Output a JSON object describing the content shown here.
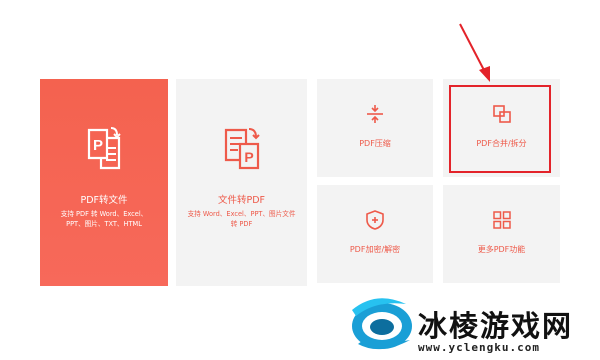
{
  "cards": {
    "pdf_to_file": {
      "title": "PDF转文件",
      "desc_line1": "支持 PDF 转 Word、Excel、",
      "desc_line2": "PPT、图片、TXT、HTML"
    },
    "file_to_pdf": {
      "title": "文件转PDF",
      "desc_line1": "支持 Word、Excel、PPT、图片文件",
      "desc_line2": "转 PDF"
    },
    "compress": {
      "label": "PDF压缩"
    },
    "merge_split": {
      "label": "PDF合并/拆分"
    },
    "encrypt": {
      "label": "PDF加密/解密"
    },
    "more": {
      "label": "更多PDF功能"
    }
  },
  "icons": {
    "pdf_to_file": "pdf-to-file-icon",
    "file_to_pdf": "file-to-pdf-icon",
    "compress": "compress-icon",
    "merge": "merge-icon",
    "shield": "shield-plus-icon",
    "grid": "grid-icon"
  },
  "watermark": {
    "title": "冰棱游戏网",
    "url": "www.yclengku.com"
  },
  "colors": {
    "accent": "#ee5a4a",
    "card_red": "#f4624f",
    "card_grey": "#f3f3f3",
    "highlight": "#e3232a"
  }
}
